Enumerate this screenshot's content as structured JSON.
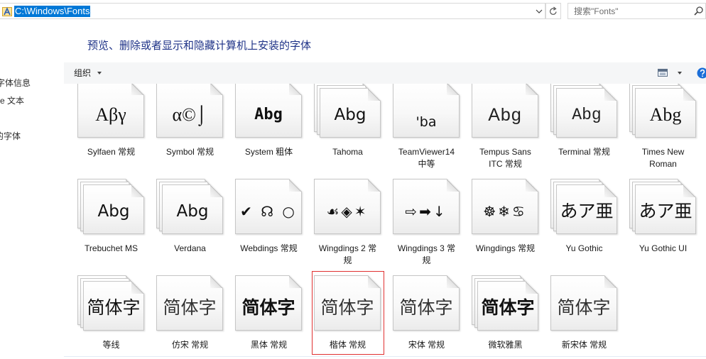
{
  "window": {
    "address_path": "C:\\Windows\\Fonts",
    "search_placeholder": "搜索\"Fonts\""
  },
  "icons": {
    "address": "fonts-folder-icon",
    "address_dropdown": "chevron-down-icon",
    "refresh": "refresh-icon",
    "search": "search-icon",
    "view": "view-options-icon",
    "help": "help-icon"
  },
  "sidebar": {
    "items": [
      {
        "label": "字体信息"
      },
      {
        "label": "e 文本"
      },
      {
        "label": "的字体"
      }
    ]
  },
  "header": {
    "title": "预览、删除或者显示和隐藏计算机上安装的字体"
  },
  "toolbar": {
    "organize_label": "组织"
  },
  "colors": {
    "accent": "#0078d7",
    "header_text": "#1e3287",
    "highlight_box": "#e03131",
    "help_icon": "#1c6fd8",
    "toolbar_bg": "#f5f6f7"
  },
  "font_list": {
    "items": [
      {
        "preview": "Αβγ",
        "label_lines": [
          "Sylfaen 常规"
        ],
        "icon": "font-file-icon"
      },
      {
        "preview": "α©⌡",
        "label_lines": [
          "Symbol 常规"
        ],
        "icon": "font-file-icon"
      },
      {
        "preview": "Abg",
        "label_lines": [
          "System 粗体"
        ],
        "icon": "font-file-icon"
      },
      {
        "preview": "Abg",
        "label_lines": [
          "Tahoma"
        ],
        "icon": "font-family-icon"
      },
      {
        "preview": "'ba",
        "label_lines": [
          "TeamViewer14",
          "中等"
        ],
        "icon": "font-file-icon"
      },
      {
        "preview": "Abg",
        "label_lines": [
          "Tempus Sans",
          "ITC 常规"
        ],
        "icon": "font-file-icon"
      },
      {
        "preview": "Abg",
        "label_lines": [
          "Terminal 常规"
        ],
        "icon": "font-family-icon"
      },
      {
        "preview": "Abg",
        "label_lines": [
          "Times New",
          "Roman"
        ],
        "icon": "font-family-icon"
      },
      {
        "preview": "Abg",
        "label_lines": [
          "Trebuchet MS"
        ],
        "icon": "font-family-icon"
      },
      {
        "preview": "Abg",
        "label_lines": [
          "Verdana"
        ],
        "icon": "font-family-icon"
      },
      {
        "preview": "✔ ☊ ○",
        "label_lines": [
          "Webdings 常规"
        ],
        "icon": "font-file-icon"
      },
      {
        "preview": "☙◈✶",
        "label_lines": [
          "Wingdings 2 常",
          "规"
        ],
        "icon": "font-file-icon"
      },
      {
        "preview": "⇨➡↓",
        "label_lines": [
          "Wingdings 3 常",
          "规"
        ],
        "icon": "font-file-icon"
      },
      {
        "preview": "☸❄♋",
        "label_lines": [
          "Wingdings 常规"
        ],
        "icon": "font-file-icon"
      },
      {
        "preview": "あア亜",
        "label_lines": [
          "Yu Gothic"
        ],
        "icon": "font-family-icon"
      },
      {
        "preview": "あア亜",
        "label_lines": [
          "Yu Gothic UI"
        ],
        "icon": "font-family-icon"
      },
      {
        "preview": "简体字",
        "label_lines": [
          "等线"
        ],
        "icon": "font-family-icon"
      },
      {
        "preview": "简体字",
        "label_lines": [
          "仿宋 常规"
        ],
        "icon": "font-file-icon"
      },
      {
        "preview": "简体字",
        "label_lines": [
          "黑体 常规"
        ],
        "icon": "font-file-icon"
      },
      {
        "preview": "简体字",
        "label_lines": [
          "楷体 常规"
        ],
        "icon": "font-file-icon",
        "selected": true
      },
      {
        "preview": "简体字",
        "label_lines": [
          "宋体 常规"
        ],
        "icon": "font-file-icon"
      },
      {
        "preview": "简体字",
        "label_lines": [
          "微软雅黑"
        ],
        "icon": "font-family-icon"
      },
      {
        "preview": "简体字",
        "label_lines": [
          "新宋体 常规"
        ],
        "icon": "font-file-icon"
      }
    ]
  }
}
